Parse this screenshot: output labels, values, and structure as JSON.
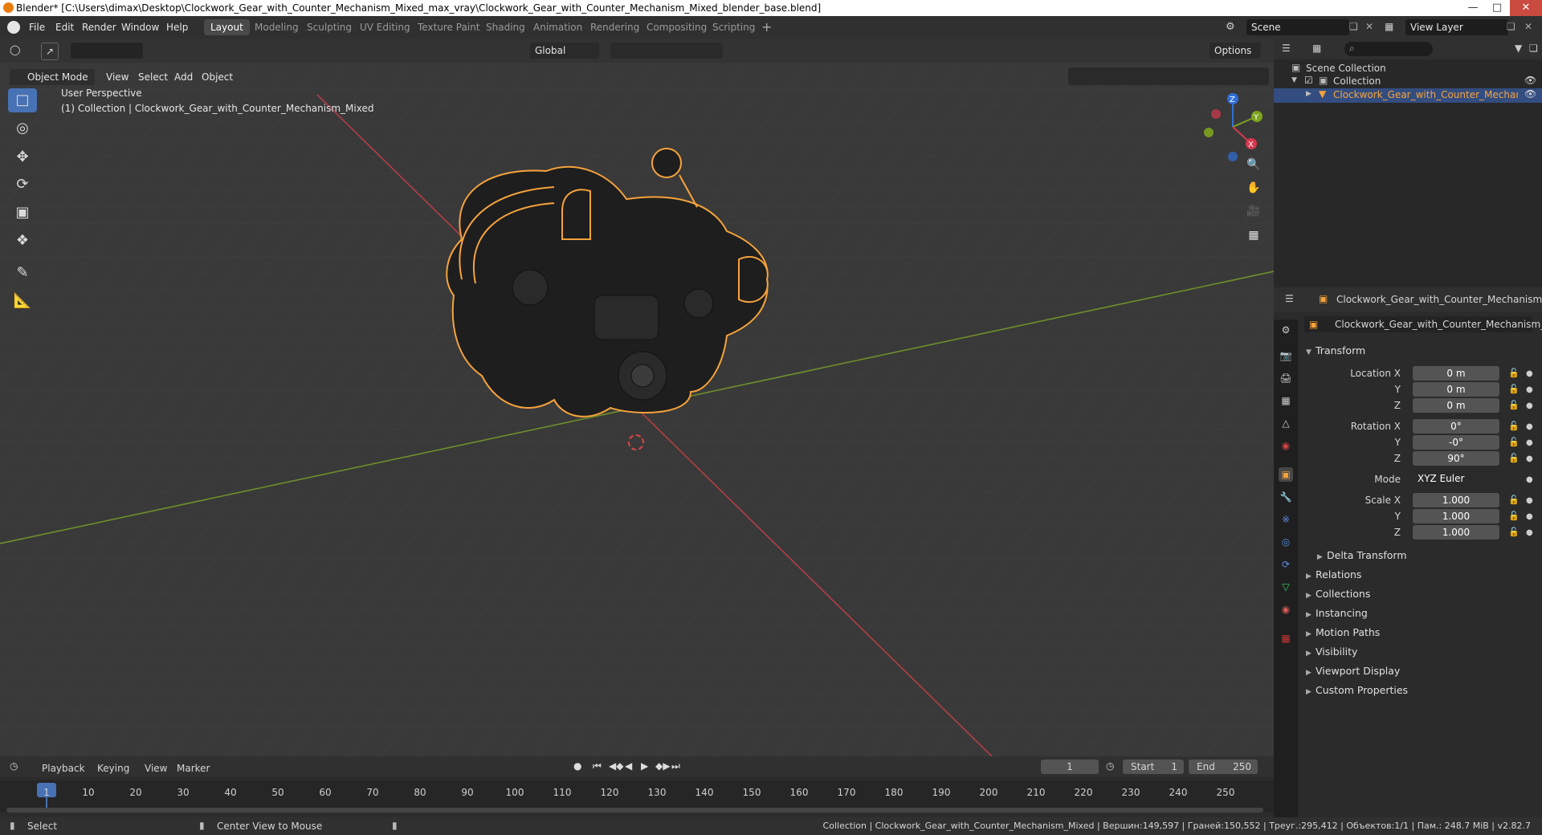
{
  "window": {
    "title": "Blender* [C:\\Users\\dimax\\Desktop\\Clockwork_Gear_with_Counter_Mechanism_Mixed_max_vray\\Clockwork_Gear_with_Counter_Mechanism_Mixed_blender_base.blend]",
    "minimize": "—",
    "maximize": "□",
    "close": "✕"
  },
  "menubar": {
    "items": [
      "File",
      "Edit",
      "Render",
      "Window",
      "Help"
    ],
    "workspaces": [
      "Layout",
      "Modeling",
      "Sculpting",
      "UV Editing",
      "Texture Paint",
      "Shading",
      "Animation",
      "Rendering",
      "Compositing",
      "Scripting"
    ],
    "active_workspace": "Layout",
    "add_workspace": "+",
    "scene_label": "Scene",
    "view_layer_label": "View Layer"
  },
  "viewport": {
    "mode": "Object Mode",
    "menus": [
      "View",
      "Select",
      "Add",
      "Object"
    ],
    "transform_orientation": "Global",
    "options": "Options",
    "perspective_label": "User Perspective",
    "collection_info": "(1) Collection | Clockwork_Gear_with_Counter_Mechanism_Mixed",
    "axis_labels": {
      "z": "Z",
      "y": "Y",
      "x": "X"
    },
    "colors": {
      "background": "#3a3a3a",
      "x_axis": "#b33e45",
      "y_axis": "#6f8f2c",
      "selection": "#f7a33c"
    }
  },
  "outliner": {
    "search_placeholder": "",
    "scene_collection": "Scene Collection",
    "collection": "Collection",
    "object": "Clockwork_Gear_with_Counter_Mechanism"
  },
  "properties": {
    "header_object": "Clockwork_Gear_with_Counter_Mechanism_Mixed",
    "object_name": "Clockwork_Gear_with_Counter_Mechanism_Mi...",
    "transform_title": "Transform",
    "location": {
      "label_x": "Location X",
      "label_y": "Y",
      "label_z": "Z",
      "x": "0 m",
      "y": "0 m",
      "z": "0 m"
    },
    "rotation": {
      "label_x": "Rotation X",
      "label_y": "Y",
      "label_z": "Z",
      "x": "0°",
      "y": "-0°",
      "z": "90°"
    },
    "mode": {
      "label": "Mode",
      "value": "XYZ Euler"
    },
    "scale": {
      "label_x": "Scale X",
      "label_y": "Y",
      "label_z": "Z",
      "x": "1.000",
      "y": "1.000",
      "z": "1.000"
    },
    "delta_transform": "Delta Transform",
    "panels": [
      "Relations",
      "Collections",
      "Instancing",
      "Motion Paths",
      "Visibility",
      "Viewport Display",
      "Custom Properties"
    ]
  },
  "timeline": {
    "menus": [
      "Playback",
      "Keying",
      "View",
      "Marker"
    ],
    "current_frame": "1",
    "start_label": "Start",
    "start": "1",
    "end_label": "End",
    "end": "250",
    "ticks": [
      "1",
      "10",
      "20",
      "30",
      "40",
      "50",
      "60",
      "70",
      "80",
      "90",
      "100",
      "110",
      "120",
      "130",
      "140",
      "150",
      "160",
      "170",
      "180",
      "190",
      "200",
      "210",
      "220",
      "230",
      "240",
      "250"
    ]
  },
  "statusbar": {
    "left_action": "Select",
    "middle_action": "Center View to Mouse",
    "stats": "Collection | Clockwork_Gear_with_Counter_Mechanism_Mixed | Вершин:149,597 | Граней:150,552 | Треуг.:295,412 | Объектов:1/1 | Пам.: 248.7 MiB | v2.82.7"
  }
}
